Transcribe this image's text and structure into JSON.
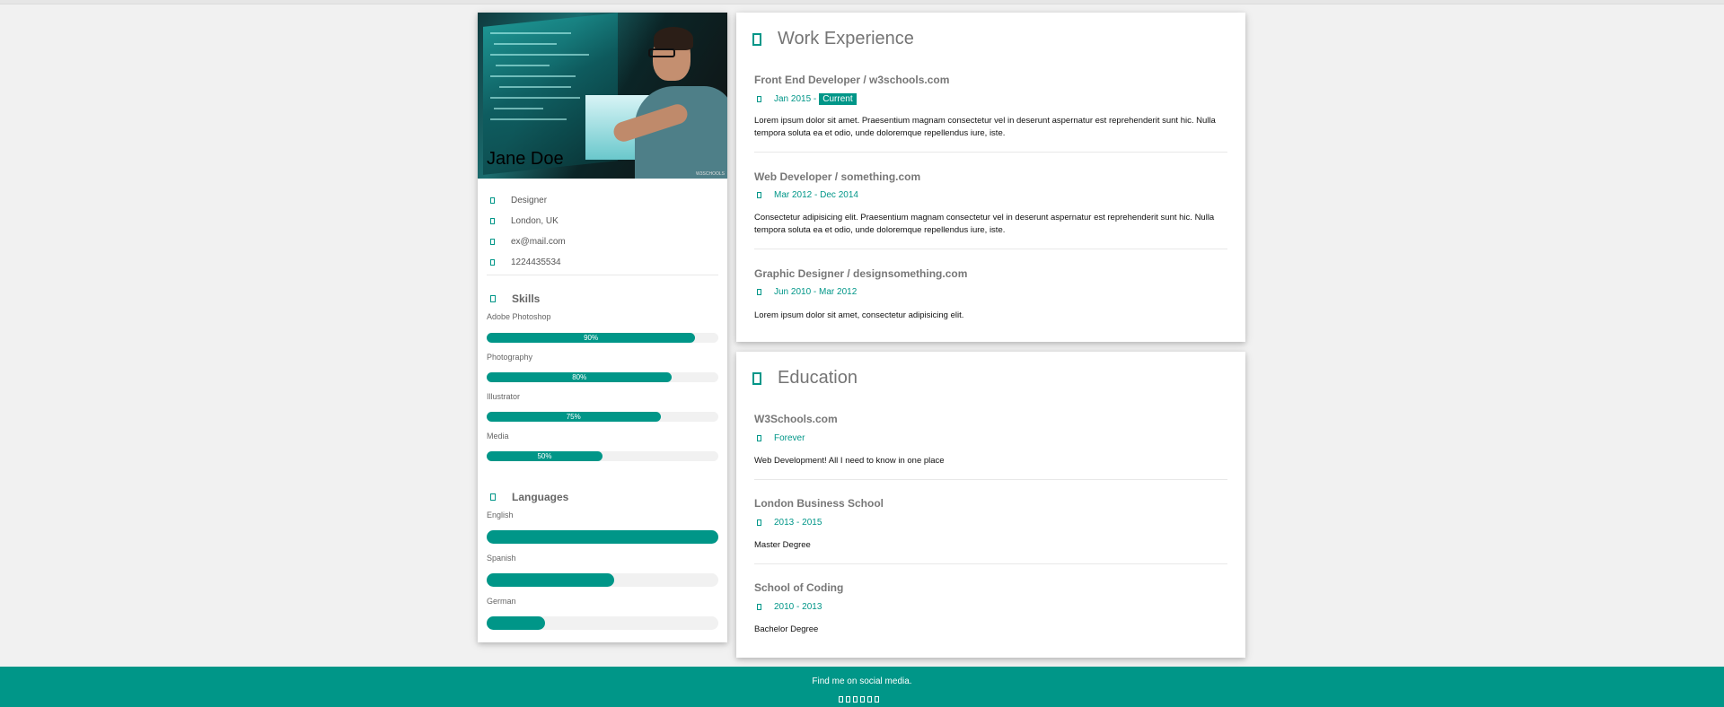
{
  "profile": {
    "name": "Jane Doe",
    "photo_credit": "W3SCHOOLS",
    "info": [
      {
        "icon": "briefcase-icon",
        "text": "Designer"
      },
      {
        "icon": "home-icon",
        "text": "London, UK"
      },
      {
        "icon": "envelope-icon",
        "text": "ex@mail.com"
      },
      {
        "icon": "phone-icon",
        "text": "1224435534"
      }
    ]
  },
  "skills": {
    "heading": "Skills",
    "icon": "asterisk-icon",
    "items": [
      {
        "label": "Adobe Photoshop",
        "percent_label": "90%",
        "value": 0.9
      },
      {
        "label": "Photography",
        "percent_label": "80%",
        "value": 0.8
      },
      {
        "label": "Illustrator",
        "percent_label": "75%",
        "value": 0.75
      },
      {
        "label": "Media",
        "percent_label": "50%",
        "value": 0.5
      }
    ]
  },
  "languages": {
    "heading": "Languages",
    "icon": "globe-icon",
    "items": [
      {
        "label": "English",
        "value": 1.0
      },
      {
        "label": "Spanish",
        "value": 0.55
      },
      {
        "label": "German",
        "value": 0.25
      }
    ]
  },
  "work": {
    "heading": "Work Experience",
    "icon": "suitcase-icon",
    "entries": [
      {
        "title": "Front End Developer / w3schools.com",
        "date": "Jan 2015 -",
        "tag": "Current",
        "desc": "Lorem ipsum dolor sit amet. Praesentium magnam consectetur vel in deserunt aspernatur est reprehenderit sunt hic. Nulla tempora soluta ea et odio, unde doloremque repellendus iure, iste."
      },
      {
        "title": "Web Developer / something.com",
        "date": "Mar 2012 - Dec 2014",
        "desc": "Consectetur adipisicing elit. Praesentium magnam consectetur vel in deserunt aspernatur est reprehenderit sunt hic. Nulla tempora soluta ea et odio, unde doloremque repellendus iure, iste."
      },
      {
        "title": "Graphic Designer / designsomething.com",
        "date": "Jun 2010 - Mar 2012",
        "desc": "Lorem ipsum dolor sit amet, consectetur adipisicing elit."
      }
    ]
  },
  "education": {
    "heading": "Education",
    "icon": "certificate-icon",
    "entries": [
      {
        "title": "W3Schools.com",
        "date": "Forever",
        "desc": "Web Development! All I need to know in one place"
      },
      {
        "title": "London Business School",
        "date": "2013 - 2015",
        "desc": "Master Degree"
      },
      {
        "title": "School of Coding",
        "date": "2010 - 2013",
        "desc": "Bachelor Degree"
      }
    ]
  },
  "footer": {
    "text": "Find me on social media.",
    "social_icons": [
      "facebook-icon",
      "instagram-icon",
      "snapchat-icon",
      "pinterest-icon",
      "twitter-icon",
      "linkedin-icon"
    ]
  },
  "colors": {
    "accent": "#009688",
    "background": "#f1f1f1"
  }
}
